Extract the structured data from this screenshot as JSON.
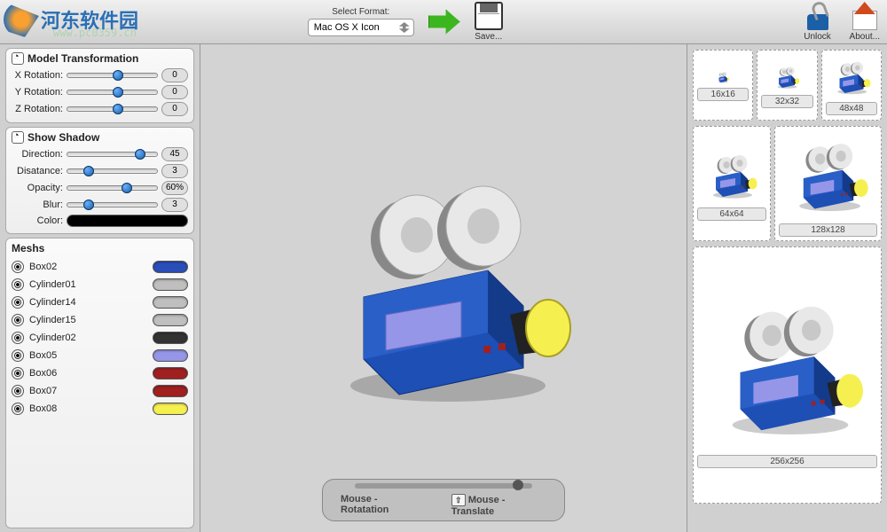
{
  "toolbar": {
    "format_label": "Select Format:",
    "format_value": "Mac OS X Icon",
    "save_label": "Save...",
    "unlock_label": "Unlock",
    "about_label": "About..."
  },
  "watermark": {
    "logo_text": "河东软件园",
    "url": "www.pc0359.cn"
  },
  "model_transform": {
    "title": "Model Transformation",
    "rows": [
      {
        "label": "X Rotation:",
        "value": "0",
        "pos": 50
      },
      {
        "label": "Y Rotation:",
        "value": "0",
        "pos": 50
      },
      {
        "label": "Z Rotation:",
        "value": "0",
        "pos": 50
      }
    ]
  },
  "shadow": {
    "title": "Show Shadow",
    "rows": [
      {
        "label": "Direction:",
        "value": "45",
        "pos": 75
      },
      {
        "label": "Disatance:",
        "value": "3",
        "pos": 18
      },
      {
        "label": "Opacity:",
        "value": "60%",
        "pos": 60
      },
      {
        "label": "Blur:",
        "value": "3",
        "pos": 18
      }
    ],
    "color_label": "Color:",
    "color": "#000000"
  },
  "meshs": {
    "title": "Meshs",
    "items": [
      {
        "name": "Box02",
        "color": "#2a4db8"
      },
      {
        "name": "Cylinder01",
        "color": "#bfbfbf"
      },
      {
        "name": "Cylinder14",
        "color": "#bfbfbf"
      },
      {
        "name": "Cylinder15",
        "color": "#bfbfbf"
      },
      {
        "name": "Cylinder02",
        "color": "#333333"
      },
      {
        "name": "Box05",
        "color": "#9696e8"
      },
      {
        "name": "Box06",
        "color": "#a02020"
      },
      {
        "name": "Box07",
        "color": "#a02020"
      },
      {
        "name": "Box08",
        "color": "#f5f050"
      }
    ]
  },
  "bottombar": {
    "left": "Mouse - Rotatation",
    "right": "Mouse - Translate"
  },
  "previews": {
    "sizes": [
      "16x16",
      "32x32",
      "48x48",
      "64x64",
      "128x128",
      "256x256"
    ]
  }
}
